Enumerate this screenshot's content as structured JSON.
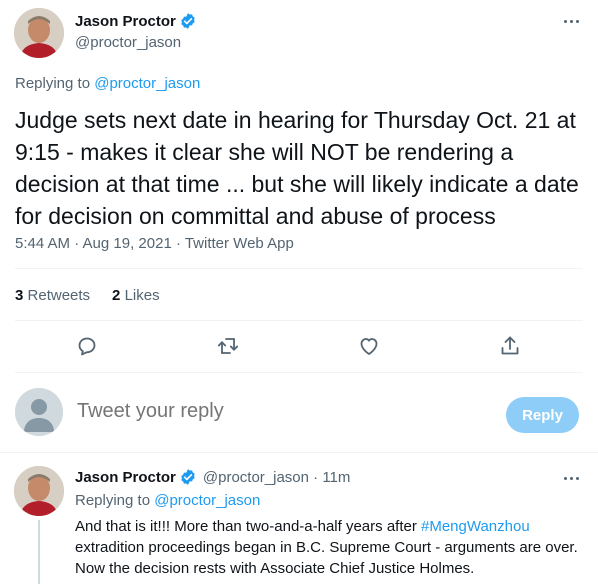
{
  "main_tweet": {
    "author_name": "Jason Proctor",
    "handle": "@proctor_jason",
    "replying_prefix": "Replying to ",
    "replying_to": "@proctor_jason",
    "text": "Judge sets next date in hearing for Thursday Oct. 21 at 9:15 - makes it clear she will NOT be rendering a decision at that time ... but she will likely indicate a date for decision on committal and abuse of process",
    "timestamp": "5:44 AM · Aug 19, 2021 · Twitter Web App",
    "retweets_count": "3",
    "retweets_label": "Retweets",
    "likes_count": "2",
    "likes_label": "Likes"
  },
  "compose": {
    "placeholder": "Tweet your reply",
    "button_label": "Reply"
  },
  "reply_tweet": {
    "author_name": "Jason Proctor",
    "handle_time": "@proctor_jason · 11m",
    "replying_prefix": "Replying to ",
    "replying_to": "@proctor_jason",
    "text_before": "And that is it!!! More than two-and-a-half years after ",
    "hashtag": "#MengWanzhou",
    "text_after": " extradition proceedings began in B.C. Supreme Court - arguments are over. Now the decision rests with Associate Chief Justice Holmes."
  },
  "colors": {
    "accent": "#1d9bf0",
    "verified": "#1d9bf0",
    "muted": "#536471",
    "reply_button_disabled": "#8ecdf8"
  },
  "icons": [
    "verified-icon",
    "more-icon",
    "reply-icon",
    "retweet-icon",
    "like-icon",
    "share-icon",
    "user-placeholder-icon"
  ]
}
